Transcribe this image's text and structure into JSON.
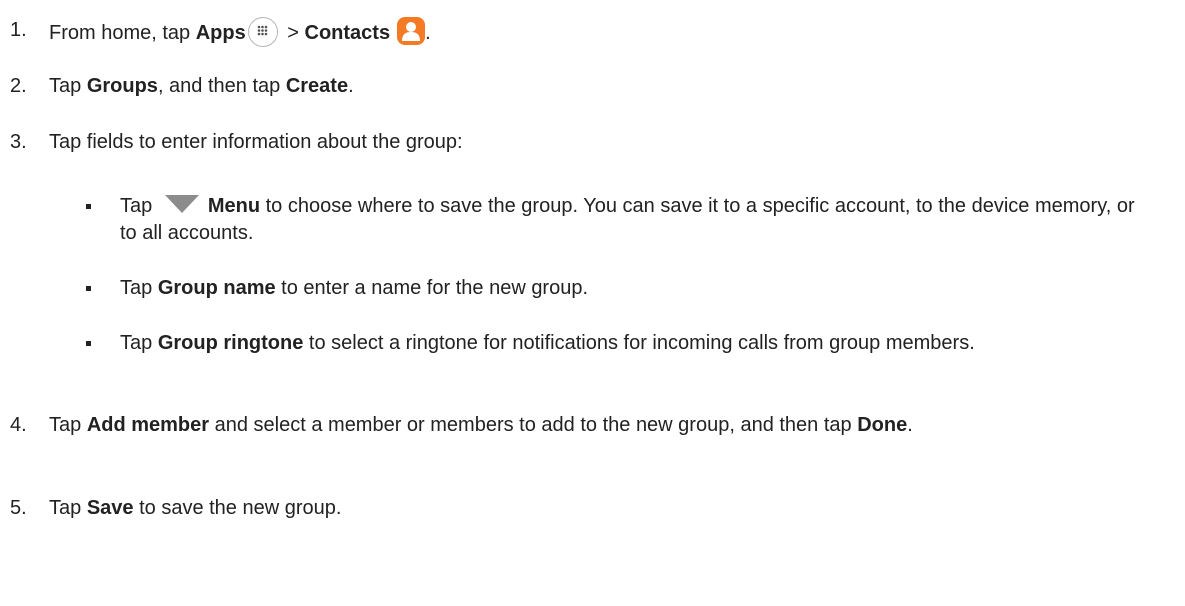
{
  "steps": [
    {
      "num": "1.",
      "prefix": "From home, tap ",
      "bold1": "Apps",
      "sep": " > ",
      "bold2": "Contacts",
      "suffix": "."
    },
    {
      "num": "2.",
      "t1": "Tap ",
      "b1": "Groups",
      "t2": ", and then tap ",
      "b2": "Create",
      "t3": "."
    },
    {
      "num": "3.",
      "text": "Tap fields to enter information about the group:"
    },
    {
      "num": "4.",
      "t1": "Tap ",
      "b1": "Add member",
      "t2": " and select a member or members to add to the new group, and then tap ",
      "b2": "Done",
      "t3": "."
    },
    {
      "num": "5.",
      "t1": "Tap ",
      "b1": "Save",
      "t2": " to save the new group."
    }
  ],
  "bullets": [
    {
      "t1": "Tap ",
      "b1": "Menu",
      "t2": " to choose where to save the group. You can save it to a specific account, to the device memory, or to all accounts."
    },
    {
      "t1": "Tap ",
      "b1": "Group name",
      "t2": " to enter a name for the new group."
    },
    {
      "t1": "Tap ",
      "b1": "Group ringtone",
      "t2": " to select a ringtone for notifications for incoming calls from group members."
    }
  ],
  "icons": {
    "apps": "apps-grid-icon",
    "contacts": "contacts-person-icon",
    "menu": "menu-triangle-icon"
  },
  "colors": {
    "text": "#222222",
    "contacts_icon": "#f47a24",
    "menu_icon": "#8c8c8c"
  }
}
